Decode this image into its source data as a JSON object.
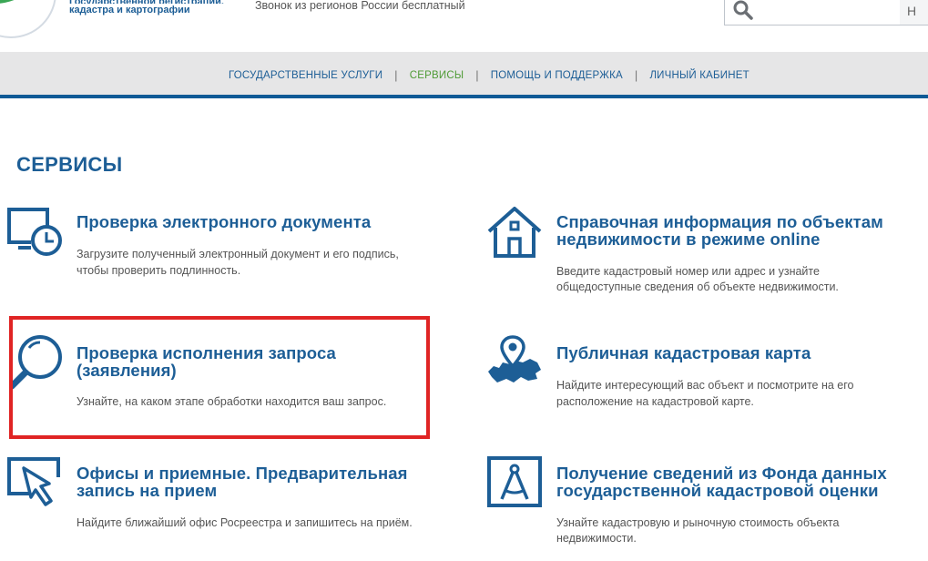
{
  "header": {
    "logo_line1": "Государственной регистрации,",
    "logo_line2": "кадастра и картографии",
    "call_text": "Звонок из регионов России бесплатный",
    "search_placeholder": "",
    "search_button_label": "Н"
  },
  "nav": {
    "items": [
      {
        "label": "ГОСУДАРСТВЕННЫЕ УСЛУГИ"
      },
      {
        "label": "СЕРВИСЫ"
      },
      {
        "label": "ПОМОЩЬ И ПОДДЕРЖКА"
      },
      {
        "label": "ЛИЧНЫЙ КАБИНЕТ"
      }
    ],
    "separator": "|",
    "active_index": 1
  },
  "page_title": "СЕРВИСЫ",
  "services": [
    {
      "title_1": "Проверка электронного документа",
      "title_2": "",
      "desc_1": "Загрузите полученный электронный документ и его подпись,",
      "desc_2": "чтобы проверить подлинность.",
      "icon": "monitor-clock-icon"
    },
    {
      "title_1": "Справочная информация по объектам",
      "title_2": "недвижимости в режиме online",
      "desc_1": "Введите кадастровый номер или адрес и узнайте",
      "desc_2": "общедоступные сведения об объекте недвижимости.",
      "icon": "house-icon"
    },
    {
      "title_1": "Проверка исполнения запроса",
      "title_2": "(заявления)",
      "desc_1": "Узнайте, на каком этапе обработки находится ваш запрос.",
      "desc_2": "",
      "icon": "magnifier-icon"
    },
    {
      "title_1": "Публичная кадастровая карта",
      "title_2": "",
      "desc_1": "Найдите интересующий вас объект и посмотрите на его",
      "desc_2": "расположение на кадастровой карте.",
      "icon": "russia-map-pin-icon"
    },
    {
      "title_1": "Офисы и приемные. Предварительная",
      "title_2": "запись на прием",
      "desc_1": "Найдите ближайший офис Росреестра и запишитесь на приём.",
      "desc_2": "",
      "icon": "cursor-frame-icon"
    },
    {
      "title_1": "Получение сведений из Фонда данных",
      "title_2": "государственной кадастровой оценки",
      "desc_1": "Узнайте кадастровую и рыночную стоимость объекта",
      "desc_2": "недвижимости.",
      "icon": "compass-frame-icon"
    }
  ],
  "colors": {
    "brand_blue": "#1d5e96",
    "nav_active_green": "#4f9b36",
    "nav_bg": "#e6e6e7",
    "highlight_red": "#e02424"
  }
}
